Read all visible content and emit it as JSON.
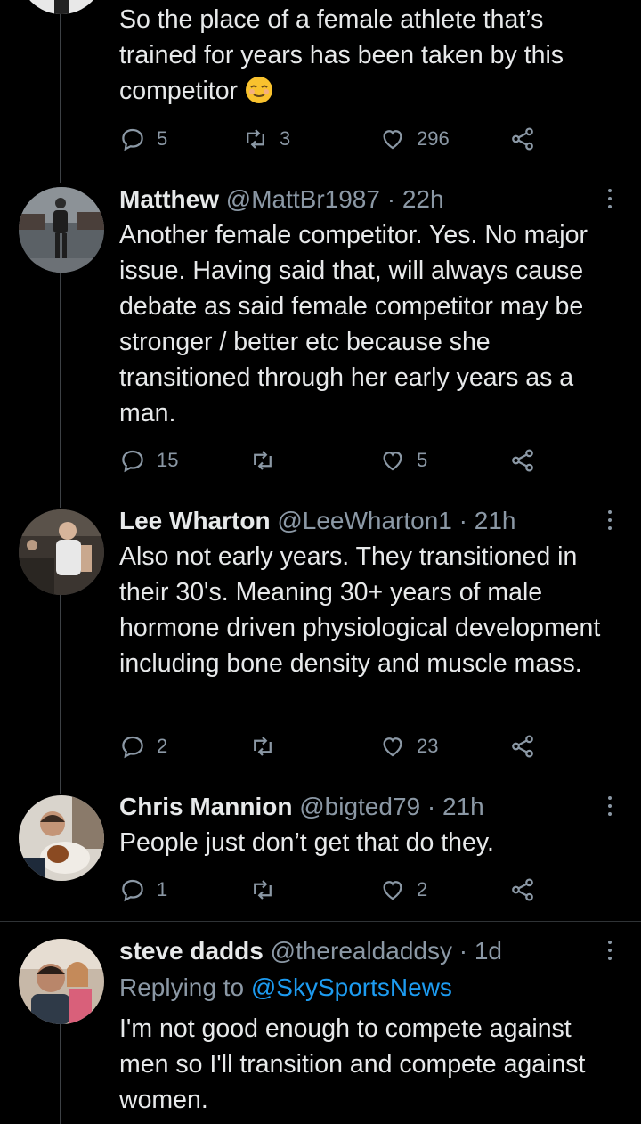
{
  "tweets": [
    {
      "text": "So the place of a female athlete that’s trained for years has been taken by this competitor",
      "emoji": "relieved-face",
      "reply_count": "5",
      "retweet_count": "3",
      "like_count": "296"
    },
    {
      "name": "Matthew",
      "handle": "@MattBr1987",
      "time": "· 22h",
      "text": "Another female competitor. Yes. No major issue. Having said that, will always cause debate as  said female competitor may be stronger / better etc because she transitioned through her early years as a man.",
      "reply_count": "15",
      "retweet_count": "",
      "like_count": "5"
    },
    {
      "name": "Lee Wharton",
      "handle": "@LeeWharton1",
      "time": "· 21h",
      "text": "Also not early years. They transitioned in their 30's. Meaning 30+ years of male hormone driven physiological development including bone density and muscle mass.",
      "reply_count": "2",
      "retweet_count": "",
      "like_count": "23"
    },
    {
      "name": "Chris Mannion",
      "handle": "@bigted79",
      "time": "· 21h",
      "text": "People just don’t get that do they.",
      "reply_count": "1",
      "retweet_count": "",
      "like_count": "2"
    },
    {
      "name": "steve dadds",
      "handle": "@therealdaddsy",
      "time": "· 1d",
      "replying_prefix": "Replying to",
      "replying_handle": "@SkySportsNews",
      "text": "I'm not good enough to compete against men so I'll transition and compete against women."
    }
  ],
  "colors": {
    "background": "#000000",
    "text": "#e7e9ea",
    "secondary": "#8b98a5",
    "link": "#1d9bf0",
    "thread_line": "#3d4145"
  }
}
